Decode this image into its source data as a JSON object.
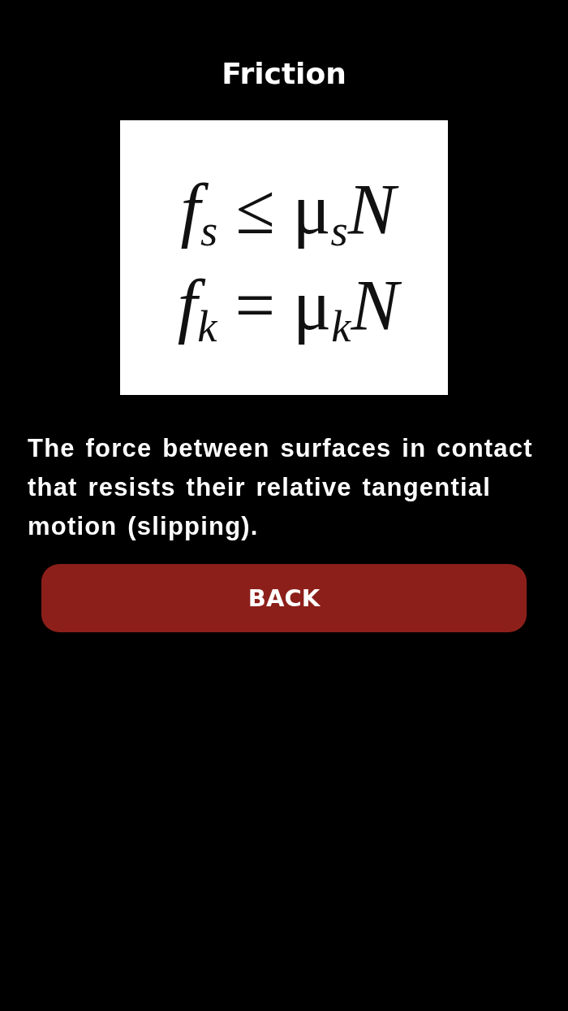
{
  "screen": {
    "title": "Friction"
  },
  "formula_card": {
    "lines": [
      "*f*$_{s}$ ≤ μ$_{s}$*N*",
      "*f*$_{k}$ = μ$_{k}$*N*"
    ]
  },
  "description": "The force between surfaces in contact that resists their relative tangential motion (slipping).",
  "buttons": [
    {
      "label": "BACK"
    }
  ]
}
